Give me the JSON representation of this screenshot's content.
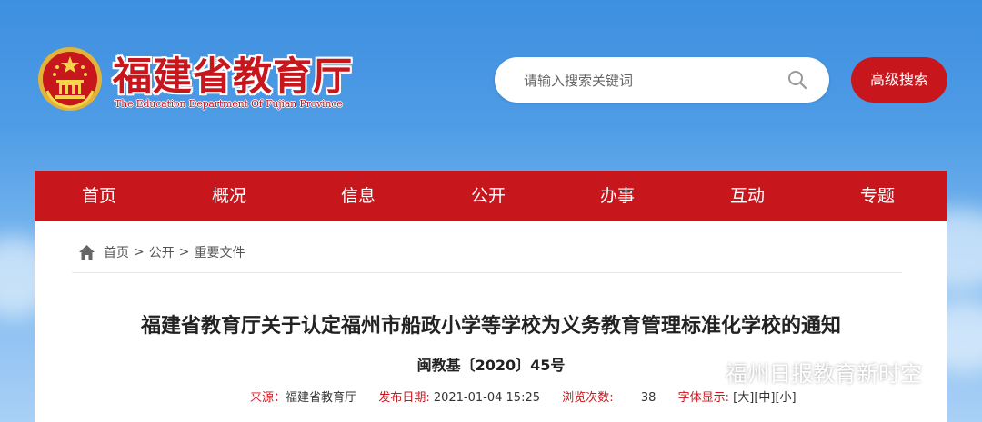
{
  "header": {
    "title": "福建省教育厅",
    "subtitle": "The Education Department Of Fujian Province",
    "search_placeholder": "请输入搜索关键词",
    "advanced_search_label": "高级搜索"
  },
  "nav": {
    "items": [
      "首页",
      "概况",
      "信息",
      "公开",
      "办事",
      "互动",
      "专题"
    ]
  },
  "breadcrumb": {
    "items": [
      "首页",
      "公开",
      "重要文件"
    ],
    "separator": ">"
  },
  "article": {
    "title": "福建省教育厅关于认定福州市船政小学等学校为义务教育管理标准化学校的通知",
    "doc_number": "闽教基〔2020〕45号",
    "source_label": "来源：",
    "source_value": "福建省教育厅",
    "date_label": "发布日期:",
    "date_value": "2021-01-04 15:25",
    "views_label": "浏览次数:",
    "views_value": "38",
    "font_label": "字体显示:",
    "font_large": "[大]",
    "font_medium": "[中]",
    "font_small": "[小]"
  },
  "watermark": {
    "text": "福州日报教育新时空"
  },
  "colors": {
    "brand_red": "#c8161d",
    "sky_blue": "#4f9ce6"
  }
}
